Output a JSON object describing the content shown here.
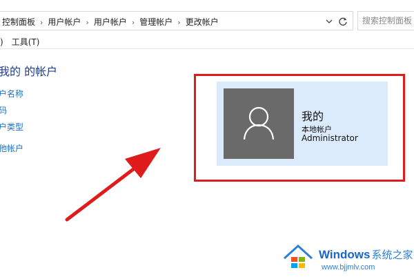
{
  "breadcrumb": {
    "items": [
      "控制面板",
      "用户帐户",
      "用户帐户",
      "管理帐户",
      "更改帐户"
    ],
    "separator": "›"
  },
  "search": {
    "placeholder": "搜索控制面板"
  },
  "menu": {
    "items": [
      ")",
      "工具(T)"
    ]
  },
  "sidebar": {
    "title": "我的 的帐户",
    "links": [
      "户名称",
      "码",
      "户类型",
      "他帐户"
    ]
  },
  "account": {
    "name": "我的",
    "type": "本地帐户",
    "role": "Administrator"
  },
  "colors": {
    "highlight": "#e01b1b",
    "card_bg": "#dcebfb",
    "avatar_bg": "#6a6a6a",
    "link": "#1a6fc4",
    "title": "#1e3d8f"
  },
  "icons": {
    "avatar": "user-silhouette-icon",
    "refresh": "refresh-icon",
    "dropdown": "chevron-down-icon",
    "arrow": "red-arrow-annotation"
  },
  "watermark": {
    "brand": "Windows",
    "suffix": "系统之家",
    "url": "www.bjjmlv.com"
  }
}
